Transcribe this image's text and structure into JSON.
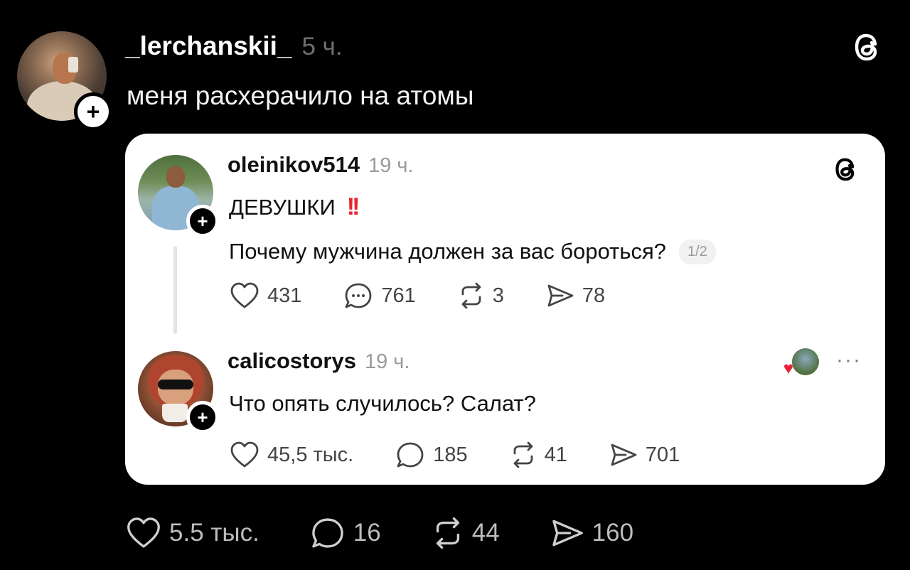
{
  "outer_post": {
    "username": "_lerchanskii_",
    "time": "5 ч.",
    "text": "меня расхерачило на атомы",
    "follow_symbol": "+",
    "actions": {
      "likes": "5.5 тыс.",
      "replies": "16",
      "reposts": "44",
      "shares": "160"
    }
  },
  "quoted_posts": [
    {
      "username": "oleinikov514",
      "time": "19 ч.",
      "line1": "ДЕВУШКИ",
      "line1_emoji": "!!",
      "line2": "Почему мужчина должен за вас бороться?",
      "page_indicator": "1/2",
      "follow_symbol": "+",
      "actions": {
        "likes": "431",
        "replies": "761",
        "reposts": "3",
        "shares": "78"
      }
    },
    {
      "username": "calicostorys",
      "time": "19 ч.",
      "text": "Что опять случилось? Салат?",
      "follow_symbol": "+",
      "more": "···",
      "actions": {
        "likes": "45,5 тыс.",
        "replies": "185",
        "reposts": "41",
        "shares": "701"
      }
    }
  ],
  "icons": {
    "threads_logo": "threads-logo-icon",
    "like": "heart-icon",
    "reply": "comment-icon",
    "repost": "repost-icon",
    "share": "share-icon"
  },
  "colors": {
    "background": "#000000",
    "card": "#ffffff",
    "accent_red": "#e6262e",
    "muted_gray": "#9a9a9a"
  }
}
